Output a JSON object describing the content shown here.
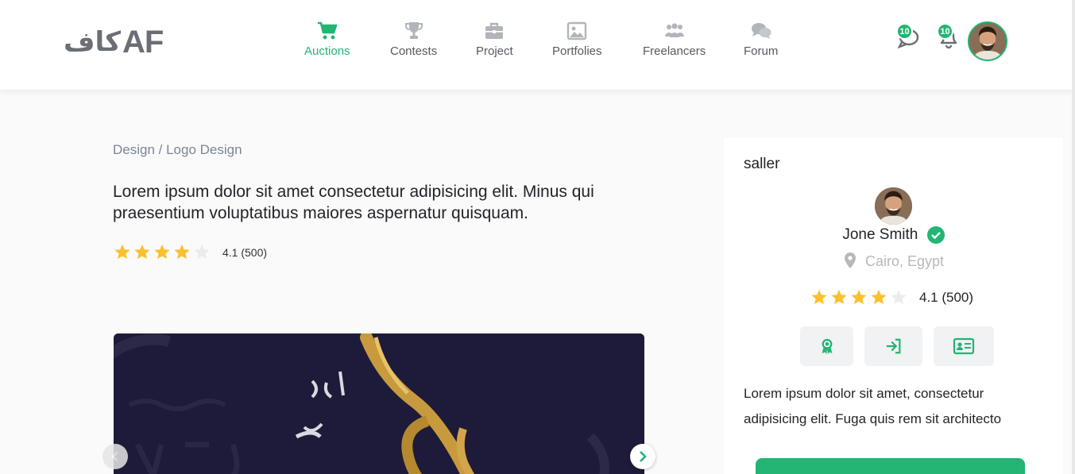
{
  "brand": {
    "arabic": "كاف",
    "latin": "AF",
    "accent": "#22b573"
  },
  "nav": {
    "items": [
      {
        "label": "Auctions",
        "icon": "cart-icon",
        "active": true
      },
      {
        "label": "Contests",
        "icon": "trophy-icon"
      },
      {
        "label": "Project",
        "icon": "briefcase-icon"
      },
      {
        "label": "Portfolies",
        "icon": "image-icon"
      },
      {
        "label": "Freelancers",
        "icon": "users-icon"
      },
      {
        "label": "Forum",
        "icon": "comments-icon"
      }
    ]
  },
  "header": {
    "messages_count": "10",
    "notifications_count": "10"
  },
  "breadcrumb": "Design / Logo Design",
  "title": "Lorem ipsum dolor sit amet consectetur adipisicing elit. Minus qui praesentium voluptatibus maiores aspernatur quisquam.",
  "rating": {
    "value": 4.1,
    "text": "4.1 (500)",
    "stars_filled": 4,
    "stars_total": 5
  },
  "seller": {
    "label": "saller",
    "name": "Jone Smith",
    "location": "Cairo, Egypt",
    "rating_text": "4.1 (500)",
    "description": "Lorem ipsum dolor sit amet, consectetur adipisicing elit. Fuga quis rem sit architecto",
    "actions": [
      "award-icon",
      "sign-in-icon",
      "id-card-icon"
    ]
  },
  "colors": {
    "star": "#fbc02d",
    "star_empty": "#e9ecef",
    "accent": "#22b573",
    "muted": "#7b8596"
  }
}
